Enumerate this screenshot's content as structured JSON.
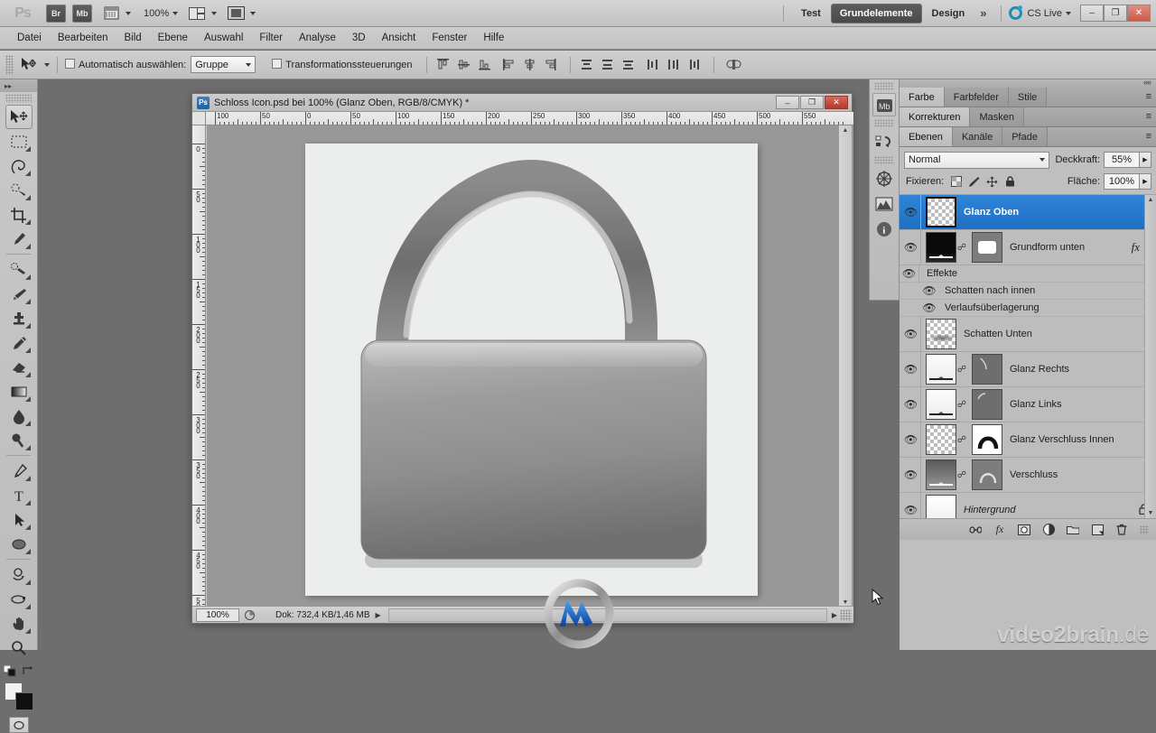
{
  "app": {
    "name": "Adobe Photoshop CS5",
    "logo_text": "Ps",
    "zoom_level": "100%",
    "bridge_button": "Br",
    "minibridge_button": "Mb",
    "workspaces": [
      {
        "label": "Test",
        "active": false
      },
      {
        "label": "Grundelemente",
        "active": true
      },
      {
        "label": "Design",
        "active": false
      }
    ],
    "overflow_label": "»",
    "cs_live": "CS Live",
    "window_buttons": {
      "minimize": "–",
      "restore": "❐",
      "close": "✕"
    }
  },
  "menubar": {
    "items": [
      "Datei",
      "Bearbeiten",
      "Bild",
      "Ebene",
      "Auswahl",
      "Filter",
      "Analyse",
      "3D",
      "Ansicht",
      "Fenster",
      "Hilfe"
    ]
  },
  "options_bar": {
    "tool": "move-tool",
    "auto_select_label": "Automatisch auswählen:",
    "auto_select_checked": false,
    "auto_select_value": "Gruppe",
    "transform_controls_label": "Transformationssteuerungen",
    "transform_controls_checked": false,
    "align_buttons": [
      "align-top-edges",
      "align-vertical-centers",
      "align-bottom-edges",
      "align-left-edges",
      "align-horizontal-centers",
      "align-right-edges"
    ],
    "distribute_buttons": [
      "distribute-top-edges",
      "distribute-vertical-centers",
      "distribute-bottom-edges",
      "distribute-left-edges",
      "distribute-horizontal-centers",
      "distribute-right-edges"
    ],
    "auto_align_button": "auto-align-layers"
  },
  "toolbox": {
    "tools": [
      {
        "name": "move-tool",
        "selected": true,
        "has_flyout": false
      },
      {
        "name": "rectangular-marquee-tool",
        "selected": false,
        "has_flyout": true
      },
      {
        "name": "lasso-tool",
        "selected": false,
        "has_flyout": true
      },
      {
        "name": "quick-selection-tool",
        "selected": false,
        "has_flyout": true
      },
      {
        "name": "crop-tool",
        "selected": false,
        "has_flyout": true
      },
      {
        "name": "eyedropper-tool",
        "selected": false,
        "has_flyout": true
      },
      {
        "name": "spot-healing-brush-tool",
        "selected": false,
        "has_flyout": true
      },
      {
        "name": "brush-tool",
        "selected": false,
        "has_flyout": true
      },
      {
        "name": "clone-stamp-tool",
        "selected": false,
        "has_flyout": true
      },
      {
        "name": "history-brush-tool",
        "selected": false,
        "has_flyout": true
      },
      {
        "name": "eraser-tool",
        "selected": false,
        "has_flyout": true
      },
      {
        "name": "gradient-tool",
        "selected": false,
        "has_flyout": true
      },
      {
        "name": "blur-tool",
        "selected": false,
        "has_flyout": true
      },
      {
        "name": "dodge-tool",
        "selected": false,
        "has_flyout": true
      },
      {
        "name": "pen-tool",
        "selected": false,
        "has_flyout": true
      },
      {
        "name": "horizontal-type-tool",
        "selected": false,
        "has_flyout": true
      },
      {
        "name": "path-selection-tool",
        "selected": false,
        "has_flyout": true
      },
      {
        "name": "ellipse-shape-tool",
        "selected": false,
        "has_flyout": true
      },
      {
        "name": "3d-object-rotate-tool",
        "selected": false,
        "has_flyout": true
      },
      {
        "name": "3d-camera-rotate-tool",
        "selected": false,
        "has_flyout": true
      },
      {
        "name": "hand-tool",
        "selected": false,
        "has_flyout": true
      },
      {
        "name": "zoom-tool",
        "selected": false,
        "has_flyout": false
      }
    ],
    "foreground_color": "#f2f2f2",
    "background_color": "#101010",
    "quick_mask": "quick-mask-mode"
  },
  "document": {
    "title": "Schloss Icon.psd bei 100% (Glanz Oben, RGB/8/CMYK) *",
    "filename": "Schloss Icon.psd",
    "zoom": "bei 100%",
    "active_layer": "Glanz Oben",
    "color_mode": "RGB/8/CMYK",
    "modified_marker": "*",
    "window_buttons": {
      "minimize": "–",
      "maximize": "❐",
      "close": "✕"
    },
    "ruler_h_labels": [
      "100",
      "50",
      "0",
      "50",
      "100",
      "150",
      "200",
      "250",
      "300",
      "350",
      "400",
      "450",
      "500",
      "550"
    ],
    "ruler_v_labels": [
      "0",
      "50",
      "100",
      "150",
      "200",
      "250",
      "300",
      "350",
      "400",
      "450",
      "500"
    ],
    "canvas_image": "padlock-icon-open-shackle"
  },
  "status_bar": {
    "zoom_value": "100%",
    "doc_info": "Dok: 732,4 KB/1,46 MB",
    "arrow": "▶"
  },
  "icon_dock": {
    "items": [
      {
        "name": "mini-bridge-icon",
        "label": "Mb"
      },
      {
        "name": "history-icon",
        "label": ""
      },
      {
        "name": "navigator-icon",
        "label": ""
      },
      {
        "name": "histogram-icon",
        "label": ""
      },
      {
        "name": "info-icon",
        "label": "i"
      }
    ]
  },
  "panels": {
    "group1_tabs": [
      {
        "label": "Farbe",
        "active": true
      },
      {
        "label": "Farbfelder",
        "active": false
      },
      {
        "label": "Stile",
        "active": false
      }
    ],
    "group2_tabs": [
      {
        "label": "Korrekturen",
        "active": true
      },
      {
        "label": "Masken",
        "active": false
      }
    ],
    "group3_tabs": [
      {
        "label": "Ebenen",
        "active": true
      },
      {
        "label": "Kanäle",
        "active": false
      },
      {
        "label": "Pfade",
        "active": false
      }
    ],
    "menu_glyph": "≡"
  },
  "layers_panel": {
    "blend_mode": "Normal",
    "opacity_label": "Deckkraft:",
    "opacity_value": "55%",
    "lock_label": "Fixieren:",
    "lock_icons": [
      "lock-transparent-pixels-icon",
      "lock-image-pixels-icon",
      "lock-position-icon",
      "lock-all-icon"
    ],
    "fill_label": "Fläche:",
    "fill_value": "100%",
    "rows": [
      {
        "name": "Glanz Oben",
        "selected": true,
        "visible": true,
        "thumb": "transparent-checker",
        "has_mask": false,
        "has_fx": false,
        "italic": false,
        "locked": false
      },
      {
        "name": "Grundform unten",
        "selected": false,
        "visible": true,
        "thumb": "black-gradient",
        "has_mask": true,
        "mask_thumb": "rounded-rect-mask",
        "has_fx": true,
        "fx_label": "fx",
        "italic": false,
        "locked": false,
        "effects_group": "Effekte",
        "effects": [
          "Schatten nach innen",
          "Verlaufsüberlagerung"
        ]
      },
      {
        "name": "Schatten Unten",
        "selected": false,
        "visible": true,
        "thumb": "transparent-shadow",
        "has_mask": false,
        "has_fx": false,
        "italic": false,
        "locked": false
      },
      {
        "name": "Glanz Rechts",
        "selected": false,
        "visible": true,
        "thumb": "white-gradient",
        "has_mask": true,
        "mask_thumb": "right-gloss-mask",
        "has_fx": false,
        "italic": false,
        "locked": false
      },
      {
        "name": "Glanz Links",
        "selected": false,
        "visible": true,
        "thumb": "white-gradient",
        "has_mask": true,
        "mask_thumb": "left-gloss-mask",
        "has_fx": false,
        "italic": false,
        "locked": false
      },
      {
        "name": "Glanz Verschluss Innen",
        "selected": false,
        "visible": true,
        "thumb": "transparent-checker",
        "has_mask": true,
        "mask_thumb": "arc-mask",
        "has_fx": false,
        "italic": false,
        "locked": false
      },
      {
        "name": "Verschluss",
        "selected": false,
        "visible": true,
        "thumb": "grey-gradient",
        "has_mask": true,
        "mask_thumb": "shackle-mask",
        "has_fx": false,
        "italic": false,
        "locked": false
      },
      {
        "name": "Hintergrund",
        "selected": false,
        "visible": true,
        "thumb": "white-flat",
        "has_mask": false,
        "has_fx": false,
        "italic": true,
        "locked": true
      }
    ],
    "footer_buttons": [
      "link-layers-icon",
      "layer-style-fx-icon",
      "add-layer-mask-icon",
      "new-adjustment-layer-icon",
      "new-group-icon",
      "new-layer-icon",
      "delete-layer-icon"
    ]
  },
  "watermark": {
    "brand_bold": "video2brain",
    "brand_light": ".de",
    "logo": "video2brain-logo"
  }
}
